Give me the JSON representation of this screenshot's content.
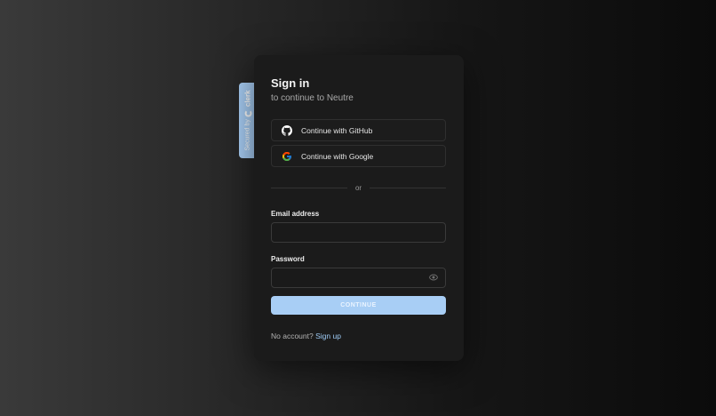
{
  "badge": {
    "prefix": "Secured by",
    "brand": "clerk"
  },
  "card": {
    "title": "Sign in",
    "subtitle": "to continue to Neutre",
    "github_label": "Continue with GitHub",
    "google_label": "Continue with Google",
    "divider_text": "or",
    "email_label": "Email address",
    "email_value": "",
    "password_label": "Password",
    "password_value": "",
    "continue_label": "CONTINUE",
    "footer_text": "No account?",
    "signup_link": "Sign up"
  },
  "colors": {
    "accent": "#a8cef5",
    "card": "#1b1b1b",
    "link": "#9ecbf5"
  },
  "icons": {
    "github": "github-icon",
    "google": "google-icon",
    "password_toggle": "eye-icon",
    "badge": "clerk-logo-icon"
  }
}
